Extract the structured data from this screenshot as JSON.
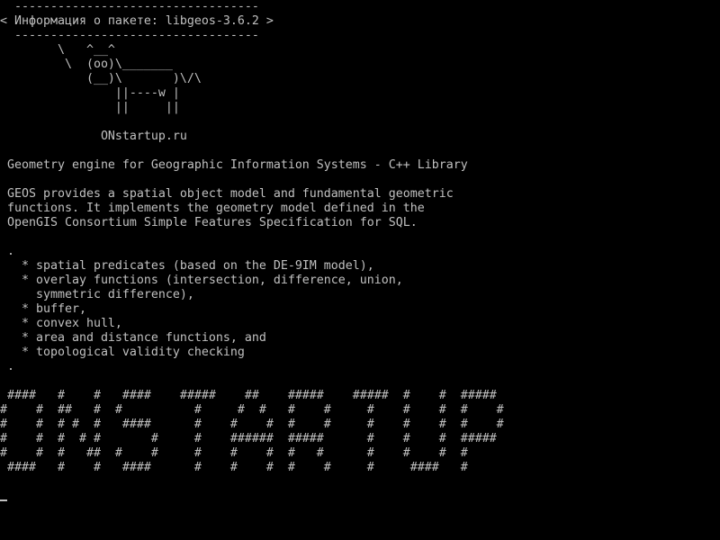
{
  "terminal": {
    "lines": [
      " ----------------------------------",
      "< Информация о пакете: libgeos-3.6.2 >",
      " ----------------------------------",
      "       \\   ^__^",
      "        \\  (oo)\\_______",
      "           (__)\\       )\\/\\",
      "               ||----w |",
      "               ||     ||",
      "",
      "             ONstartup.ru",
      "",
      "Geometry engine for Geographic Information Systems - C++ Library",
      "",
      "GEOS provides a spatial object model and fundamental geometric",
      "functions. It implements the geometry model defined in the",
      "OpenGIS Consortium Simple Features Specification for SQL.",
      "",
      ".",
      "  * spatial predicates (based on the DE-9IM model),",
      "  * overlay functions (intersection, difference, union,",
      "    symmetric difference),",
      "  * buffer,",
      "  * convex hull,",
      "  * area and distance functions, and",
      "  * topological validity checking",
      ".",
      "",
      " ####   #    #   ####    #####    ##    #####    #####  #    #  #####",
      "#    #  ##   #  #          #     #  #   #    #     #    #    #  #    #",
      "#    #  # #  #   ####      #    #    #  #    #     #    #    #  #    #",
      "#    #  #  # #       #     #    ######  #####      #    #    #  #####",
      "#    #  #   ##  #    #     #    #    #  #   #      #    #    #  #",
      " ####   #    #   ####      #    #    #  #    #     #     ####   #"
    ]
  }
}
